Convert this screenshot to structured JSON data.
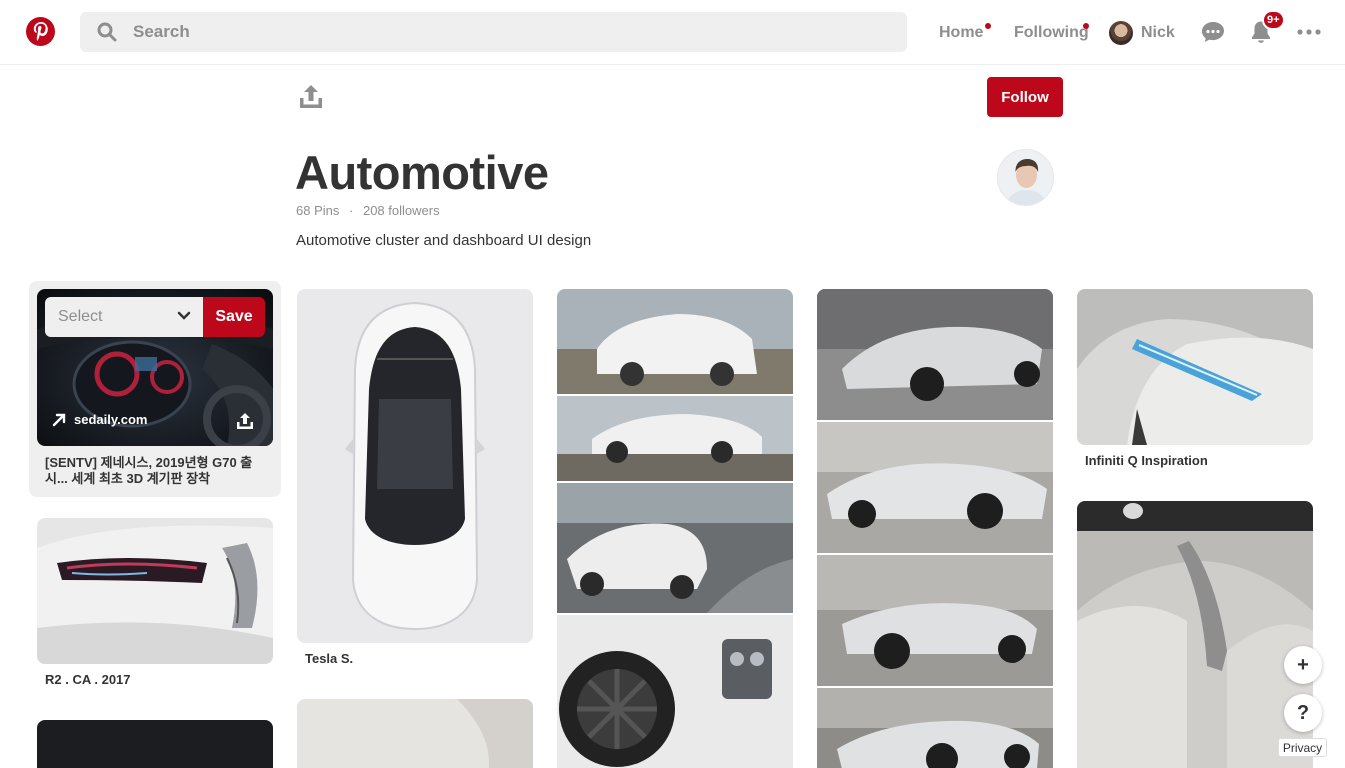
{
  "header": {
    "search_placeholder": "Search",
    "nav": {
      "home": "Home",
      "following": "Following",
      "user": "Nick"
    },
    "notifications_badge": "9+"
  },
  "board": {
    "title": "Automotive",
    "pins_count": "68 Pins",
    "followers_count": "208 followers",
    "meta_separator": "·",
    "description": "Automotive cluster and dashboard UI design",
    "follow_label": "Follow"
  },
  "pins": {
    "hovered": {
      "select_placeholder": "Select",
      "save_label": "Save",
      "source": "sedaily.com",
      "title": "[SENTV] 제네시스, 2019년형 G70 출시... 세계 최초 3D 계기판 장착"
    },
    "titles": [
      "R2 . CA . 2017",
      "Tesla S.",
      "Infiniti Q Inspiration"
    ]
  },
  "floating": {
    "add": "+",
    "help": "?",
    "privacy": "Privacy"
  },
  "colors": {
    "brand_red": "#bd081c",
    "text_dark": "#333333",
    "text_muted": "#8e8e8e",
    "search_bg": "#efefef"
  }
}
